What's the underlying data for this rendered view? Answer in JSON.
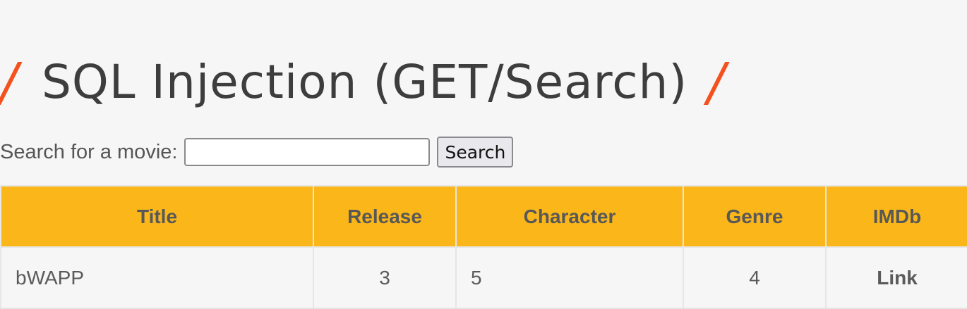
{
  "heading": {
    "slash_left": "/",
    "title": "SQL Injection (GET/Search)",
    "slash_right": "/"
  },
  "search": {
    "label": "Search for a movie:",
    "value": "",
    "button_label": "Search"
  },
  "table": {
    "headers": [
      "Title",
      "Release",
      "Character",
      "Genre",
      "IMDb"
    ],
    "rows": [
      {
        "title": "bWAPP",
        "release": "3",
        "character": "5",
        "genre": "4",
        "imdb": "Link"
      }
    ]
  },
  "colors": {
    "accent": "#f4511e",
    "header_background": "#fbb719",
    "page_background": "#f6f6f6"
  }
}
